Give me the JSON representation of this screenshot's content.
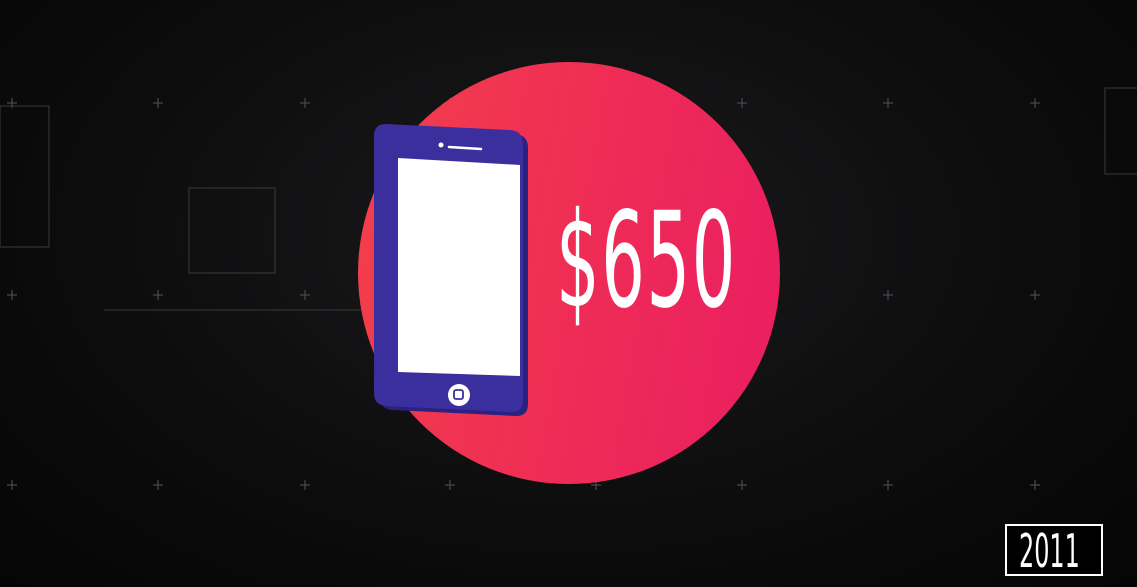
{
  "scene": {
    "price_label": "$650",
    "year_label": "2011"
  },
  "colors": {
    "background": "#0b0b0c",
    "circle": "#ef2d55",
    "phone_body": "#3b2f9e",
    "phone_screen": "#ffffff",
    "text": "#ffffff"
  },
  "icons": {
    "phone": "smartphone-icon"
  }
}
